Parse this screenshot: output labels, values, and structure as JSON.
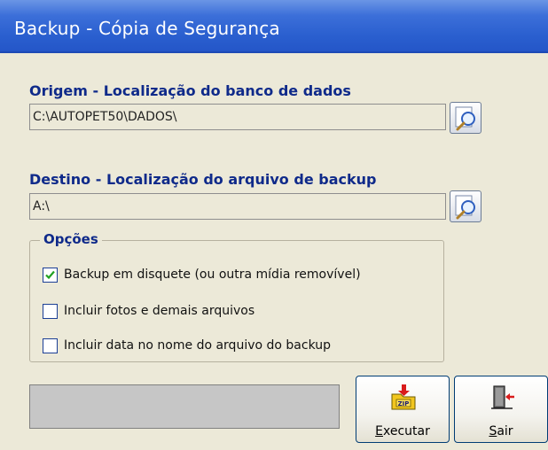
{
  "window": {
    "title": "Backup - Cópia de Segurança"
  },
  "origin": {
    "label": "Origem - Localização do banco de dados",
    "value": "C:\\AUTOPET50\\DADOS\\"
  },
  "destination": {
    "label": "Destino - Localização do arquivo de backup",
    "value": "A:\\"
  },
  "options": {
    "legend": "Opções",
    "items": [
      {
        "label": "Backup em disquete (ou outra mídia removível)",
        "checked": true
      },
      {
        "label": "Incluir fotos e demais arquivos",
        "checked": false
      },
      {
        "label": "Incluir data no nome do arquivo do backup",
        "checked": false
      }
    ]
  },
  "progress": {
    "value": 0
  },
  "buttons": {
    "execute_first": "E",
    "execute_rest": "xecutar",
    "exit_first": "S",
    "exit_rest": "air"
  },
  "icons": {
    "browse": "magnifier-icon",
    "execute": "zip-icon",
    "exit": "exit-door-icon"
  },
  "colors": {
    "title_bar": "#2a5fcf",
    "label_text": "#0f2a8a",
    "window_bg": "#ece9d8"
  }
}
